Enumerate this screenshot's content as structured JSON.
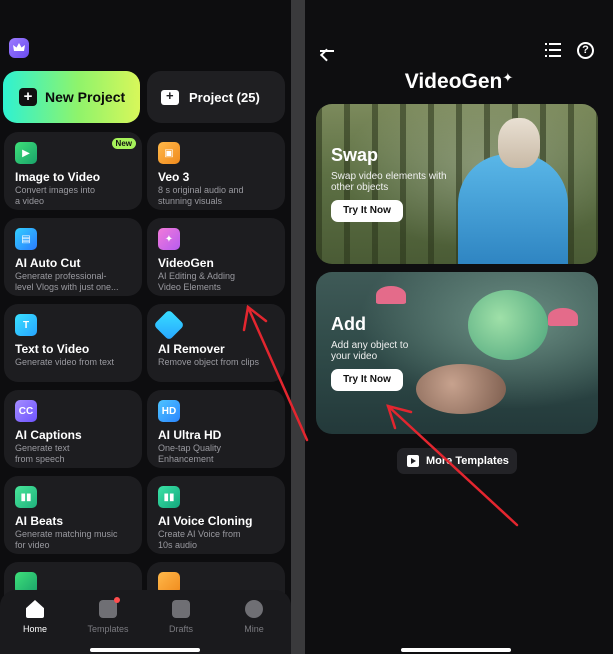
{
  "left": {
    "new_project": "New Project",
    "project": "Project (25)",
    "tools": [
      {
        "title": "Image to Video",
        "sub": "Convert images into\na video",
        "badge": "New",
        "icon": "image-to-video-icon"
      },
      {
        "title": "Veo 3",
        "sub": "8 s original audio and\nstunning visuals",
        "icon": "veo3-icon"
      },
      {
        "title": "AI Auto Cut",
        "sub": "Generate professional-\nlevel Vlogs with just one...",
        "icon": "auto-cut-icon"
      },
      {
        "title": "VideoGen",
        "sub": "AI Editing & Adding\nVideo Elements",
        "icon": "videogen-icon"
      },
      {
        "title": "Text to Video",
        "sub": "Generate video from text",
        "icon": "text-to-video-icon"
      },
      {
        "title": "AI Remover",
        "sub": "Remove object from clips",
        "icon": "eraser-icon"
      },
      {
        "title": "AI Captions",
        "sub": "Generate text\nfrom speech",
        "icon": "cc-icon"
      },
      {
        "title": "AI Ultra HD",
        "sub": "One-tap Quality\nEnhancement",
        "icon": "hd-icon"
      },
      {
        "title": "AI Beats",
        "sub": "Generate matching music\nfor video",
        "icon": "beats-icon"
      },
      {
        "title": "AI Voice Cloning",
        "sub": "Create AI Voice from\n10s audio",
        "icon": "voice-icon"
      }
    ],
    "tabs": [
      "Home",
      "Templates",
      "Drafts",
      "Mine"
    ]
  },
  "right": {
    "title": "VideoGen",
    "swap": {
      "title": "Swap",
      "sub": "Swap video elements with\nother objects",
      "button": "Try It Now"
    },
    "add": {
      "title": "Add",
      "sub": "Add any object to\nyour video",
      "button": "Try It Now"
    },
    "more": "More Templates"
  },
  "colors": {
    "accent_start": "#2ef2d2",
    "accent_end": "#d8f75a",
    "arrow": "#e3262f",
    "badge": "#a6f25a"
  }
}
